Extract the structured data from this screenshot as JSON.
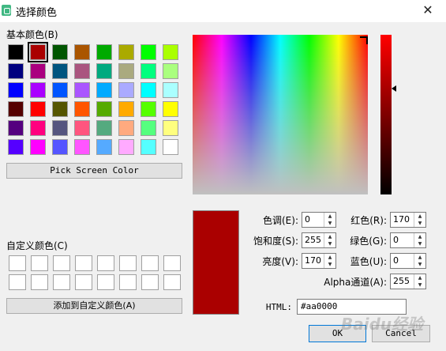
{
  "window": {
    "title": "选择颜色",
    "close_glyph": "✕"
  },
  "basic_colors": {
    "label": "基本颜色(B)",
    "swatches": [
      [
        "#000000",
        "#aa0000",
        "#005500",
        "#aa5500",
        "#00aa00",
        "#aaaa00",
        "#00ff00",
        "#aaff00"
      ],
      [
        "#00007f",
        "#aa007f",
        "#00557f",
        "#aa557f",
        "#00aa7f",
        "#aaaa7f",
        "#00ff7f",
        "#aaff7f"
      ],
      [
        "#0000ff",
        "#aa00ff",
        "#0055ff",
        "#aa55ff",
        "#00aaff",
        "#aaaaff",
        "#00ffff",
        "#aaffff"
      ],
      [
        "#550000",
        "#ff0000",
        "#555500",
        "#ff5500",
        "#55aa00",
        "#ffaa00",
        "#55ff00",
        "#ffff00"
      ],
      [
        "#55007f",
        "#ff007f",
        "#55557f",
        "#ff557f",
        "#55aa7f",
        "#ffaa7f",
        "#55ff7f",
        "#ffff7f"
      ],
      [
        "#5500ff",
        "#ff00ff",
        "#5555ff",
        "#ff55ff",
        "#55aaff",
        "#ffaaff",
        "#55ffff",
        "#ffffff"
      ]
    ],
    "selected_row": 0,
    "selected_col": 1
  },
  "pick_button": {
    "label": "Pick Screen Color"
  },
  "custom_colors": {
    "label": "自定义颜色(C)",
    "rows": 2,
    "cols": 8
  },
  "add_button": {
    "label": "添加到自定义颜色(A)"
  },
  "preview": {
    "color": "#aa0000"
  },
  "fields": {
    "hue": {
      "label": "色调(E):",
      "value": "0"
    },
    "sat": {
      "label": "饱和度(S):",
      "value": "255"
    },
    "val": {
      "label": "亮度(V):",
      "value": "170"
    },
    "red": {
      "label": "红色(R):",
      "value": "170"
    },
    "green": {
      "label": "绿色(G):",
      "value": "0"
    },
    "blue": {
      "label": "蓝色(U):",
      "value": "0"
    },
    "alpha": {
      "label": "Alpha通道(A):",
      "value": "255"
    },
    "html": {
      "label": "HTML:",
      "value": "#aa0000"
    }
  },
  "buttons": {
    "ok": "OK",
    "cancel": "Cancel"
  },
  "watermark": {
    "text": "Baidu经验"
  }
}
